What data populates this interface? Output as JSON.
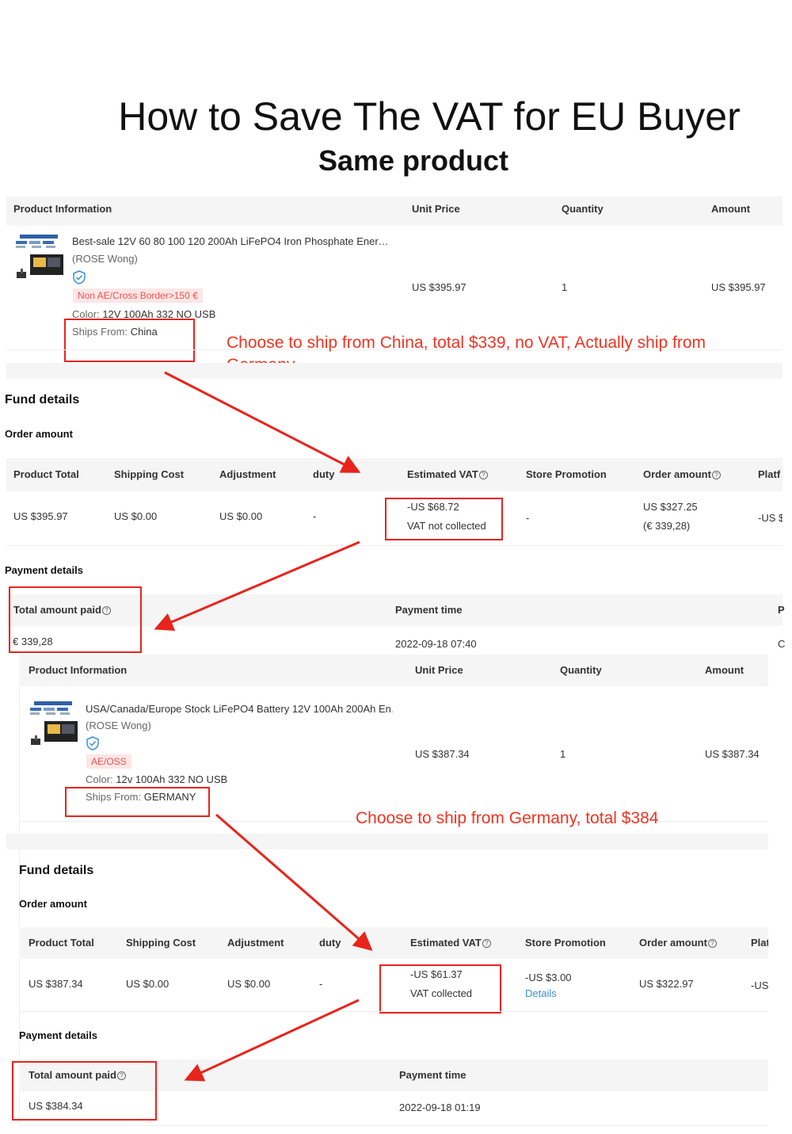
{
  "header": {
    "title": "How to Save The VAT for EU Buyer",
    "subtitle": "Same product"
  },
  "order1": {
    "columns": {
      "product_info": "Product Information",
      "unit_price": "Unit Price",
      "quantity": "Quantity",
      "amount": "Amount"
    },
    "product": {
      "name": "Best-sale 12V 60 80 100 120 200Ah LiFePO4 Iron Phosphate Ener…",
      "store": "(ROSE Wong)",
      "tag": "Non AE/Cross Border>150 €",
      "color_label": "Color:",
      "color_value": "12V 100Ah 332 NO USB",
      "ships_label": "Ships From:",
      "ships_value": "China",
      "unit_price": "US $395.97",
      "quantity": "1",
      "amount": "US $395.97"
    },
    "annotation": "Choose to ship from China, total $339, no VAT, Actually ship from",
    "annotation_line2": "Germany",
    "fund_title": "Fund details",
    "order_amount_title": "Order amount",
    "fund_columns": {
      "product_total": "Product Total",
      "shipping": "Shipping Cost",
      "adjustment": "Adjustment",
      "duty": "duty",
      "vat": "Estimated VAT",
      "promo": "Store Promotion",
      "order_amount": "Order amount",
      "platform": "Platf"
    },
    "fund_values": {
      "product_total": "US $395.97",
      "shipping": "US $0.00",
      "adjustment": "US $0.00",
      "duty": "-",
      "vat": "-US $68.72",
      "vat_status": "VAT not collected",
      "promo": "-",
      "order_amount": "US $327.25",
      "order_amount_eur": "(€ 339,28)",
      "platform": "-US $"
    },
    "payment_title": "Payment details",
    "payment_columns": {
      "total_paid": "Total amount paid",
      "payment_time": "Payment time",
      "extra": "P"
    },
    "payment_values": {
      "total_paid": "€ 339,28",
      "payment_time": "2022-09-18 07:40",
      "extra": "C"
    }
  },
  "order2": {
    "columns": {
      "product_info": "Product Information",
      "unit_price": "Unit Price",
      "quantity": "Quantity",
      "amount": "Amount"
    },
    "product": {
      "name": "USA/Canada/Europe Stock LiFePO4 Battery 12V 100Ah 200Ah En…",
      "store": "(ROSE Wong)",
      "tag": "AE/OSS",
      "color_label": "Color:",
      "color_value": "12v 100Ah 332 NO USB",
      "ships_label": "Ships From:",
      "ships_value": "GERMANY",
      "unit_price": "US $387.34",
      "quantity": "1",
      "amount": "US $387.34"
    },
    "annotation": "Choose to ship from Germany, total $384",
    "fund_title": "Fund details",
    "order_amount_title": "Order amount",
    "fund_columns": {
      "product_total": "Product Total",
      "shipping": "Shipping Cost",
      "adjustment": "Adjustment",
      "duty": "duty",
      "vat": "Estimated VAT",
      "promo": "Store Promotion",
      "order_amount": "Order amount",
      "platform": "Plat"
    },
    "fund_values": {
      "product_total": "US $387.34",
      "shipping": "US $0.00",
      "adjustment": "US $0.00",
      "duty": "-",
      "vat": "-US $61.37",
      "vat_status": "VAT collected",
      "promo": "-US $3.00",
      "promo_link": "Details",
      "order_amount": "US $322.97",
      "platform": "-US"
    },
    "payment_title": "Payment details",
    "payment_columns": {
      "total_paid": "Total amount paid",
      "payment_time": "Payment time"
    },
    "payment_values": {
      "total_paid": "US $384.34",
      "payment_time": "2022-09-18 01:19"
    }
  },
  "colors": {
    "annotation_red": "#e8241c",
    "link_blue": "#3a8fd6",
    "tag_red": "#f05151",
    "header_gray": "#f5f5f5"
  }
}
